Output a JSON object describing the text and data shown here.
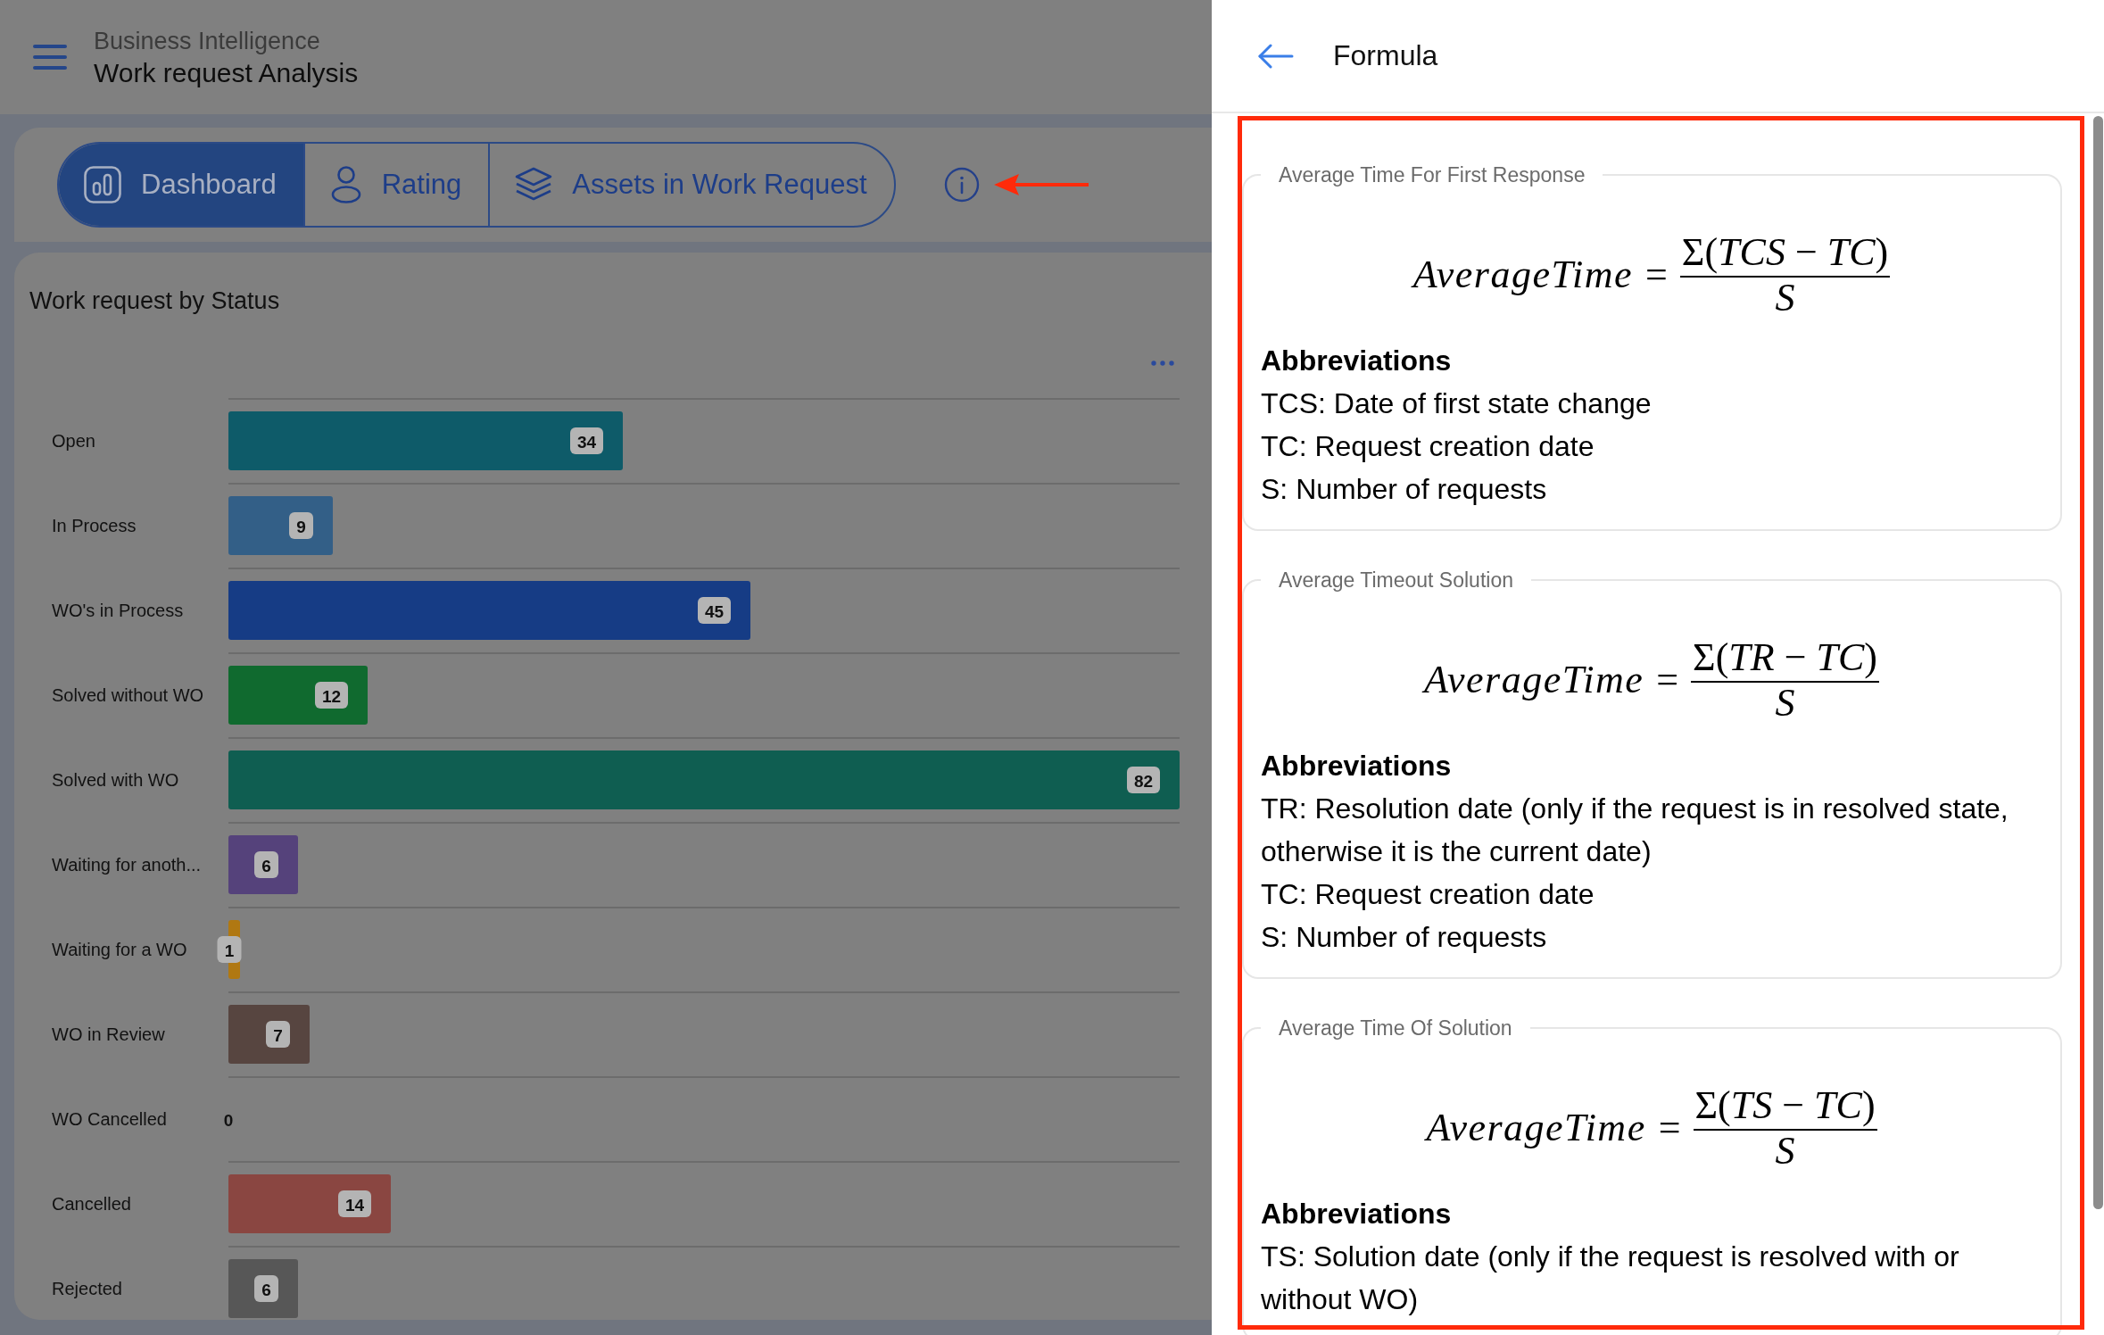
{
  "app_bar": {
    "subtitle": "Business Intelligence",
    "title": "Work request Analysis"
  },
  "tabs": [
    {
      "label": "Dashboard",
      "selected": true
    },
    {
      "label": "Rating",
      "selected": false
    },
    {
      "label": "Assets in Work Request",
      "selected": false
    }
  ],
  "status_chart": {
    "chart_data": {
      "type": "bar",
      "orientation": "horizontal",
      "title": "Work request by Status",
      "categories": [
        "Open",
        "In Process",
        "WO's in Process",
        "Solved without WO",
        "Solved with WO",
        "Waiting for anoth...",
        "Waiting for a WO",
        "WO in Review",
        "WO Cancelled",
        "Cancelled",
        "Rejected"
      ],
      "series": [
        {
          "values": [
            34,
            9,
            45,
            12,
            82,
            6,
            1,
            7,
            0,
            14,
            6
          ],
          "colors": [
            "#0e5b69",
            "#335f87",
            "#163c85",
            "#106a2f",
            "#0f5e51",
            "#55427b",
            "#b07812",
            "#574540",
            null,
            "#8a4641",
            "#575757"
          ]
        }
      ],
      "data_labels": true
    }
  },
  "formula_panel": {
    "title": "Formula",
    "sections": [
      {
        "legend": "Average Time For First Response",
        "formula": {
          "lhs": "AverageTime",
          "operator": "=",
          "numerator": "Σ(*TCS* − *TC*)",
          "denominator": "S"
        },
        "heading": "Abbreviations",
        "lines": [
          "TCS: Date of first state change",
          "TC: Request creation date",
          "S: Number of requests"
        ]
      },
      {
        "legend": "Average Timeout Solution",
        "formula": {
          "lhs": "AverageTime",
          "operator": "=",
          "numerator": "Σ(*TR* − *TC*)",
          "denominator": "S"
        },
        "heading": "Abbreviations",
        "lines": [
          "TR: Resolution date (only if the request is in resolved state, otherwise it is the current date)",
          "TC: Request creation date",
          "S: Number of requests"
        ]
      },
      {
        "legend": "Average Time Of Solution",
        "formula": {
          "lhs": "AverageTime",
          "operator": "=",
          "numerator": "Σ(*TS* − *TC*)",
          "denominator": "S"
        },
        "heading": "Abbreviations",
        "lines": [
          "TS: Solution date (only if the request is resolved with or without WO)"
        ]
      }
    ]
  }
}
